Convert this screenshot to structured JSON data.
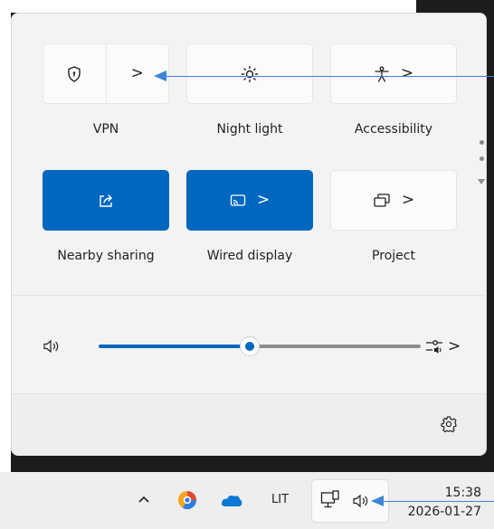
{
  "quick_settings": {
    "tiles_row1": [
      {
        "label": "VPN",
        "icon": "vpn-shield-icon",
        "active": false,
        "chevron": ">"
      },
      {
        "label": "Night light",
        "icon": "night-light-icon",
        "active": false
      },
      {
        "label": "Accessibility",
        "icon": "accessibility-icon",
        "active": false,
        "chevron": ">"
      }
    ],
    "tiles_row2": [
      {
        "label": "Nearby sharing",
        "icon": "nearby-sharing-icon",
        "active": true
      },
      {
        "label": "Wired display",
        "icon": "cast-icon",
        "active": true,
        "chevron": ">"
      },
      {
        "label": "Project",
        "icon": "project-icon",
        "active": false,
        "chevron": ">"
      }
    ],
    "volume": {
      "level": 0.47,
      "icon": "speaker-icon",
      "mixer_icon": "sound-output-icon",
      "chevron": ">"
    },
    "settings_icon": "gear-icon",
    "accent_color": "#0067c0"
  },
  "taskbar": {
    "language": "LIT",
    "time": "15:38",
    "date": "2026-01-27",
    "icons": [
      "chevron-up-icon",
      "app-icon",
      "onedrive-icon",
      "network-icon",
      "speaker-icon"
    ]
  }
}
